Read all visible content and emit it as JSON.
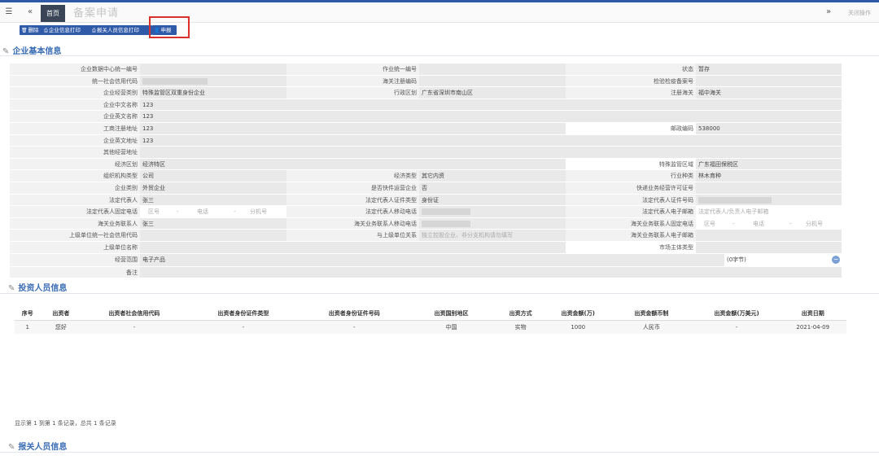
{
  "header": {
    "menu_icon": "hamburger-icon",
    "back_icon": "double-left-icon",
    "home_tab": "首页",
    "current_tab": "备案申请",
    "forward_icon": "double-right-icon",
    "close_ops": "关闭操作"
  },
  "toolbar": {
    "delete": "删除",
    "print_company": "企业信息打印",
    "print_declarer": "报关人员信息打印",
    "submit": "申报"
  },
  "sections": {
    "company": "企业基本信息",
    "investor": "投资人员信息",
    "declarer": "报关人员信息"
  },
  "form": {
    "r1": {
      "l1": "企业数据中心统一编号",
      "v1": "",
      "l2": "作业统一编号",
      "v2": "",
      "l3": "状态",
      "v3": "暂存"
    },
    "r2": {
      "l1": "统一社会信用代码",
      "v1": "",
      "l2": "海关注册编码",
      "v2": "",
      "l3": "检验检疫备案号",
      "v3": ""
    },
    "r3": {
      "l1": "企业经营类别",
      "v1": "特殊监管区双重身份企业",
      "l2": "行政区划",
      "v2": "广东省深圳市南山区",
      "l3": "注册海关",
      "v3": "福中海关"
    },
    "r4": {
      "l1": "企业中文名称",
      "v1": "123"
    },
    "r5": {
      "l1": "企业英文名称",
      "v1": "123"
    },
    "r6": {
      "l1": "工商注册地址",
      "v1": "123",
      "l3": "邮政编码",
      "v3": "538000"
    },
    "r7": {
      "l1": "企业英文地址",
      "v1": "123"
    },
    "r8": {
      "l1": "其他经营地址",
      "v1": ""
    },
    "r9": {
      "l1": "经济区划",
      "v1": "经济特区",
      "l3": "特殊监管区域",
      "v3": "广东福田保税区"
    },
    "r10": {
      "l1": "组织机构类型",
      "v1": "公司",
      "l2": "经济类型",
      "v2": "其它内资",
      "l3": "行业种类",
      "v3": "林木育种"
    },
    "r11": {
      "l1": "企业类别",
      "v1": "外贸企业",
      "l2": "是否快件运营企业",
      "v2": "否",
      "l3": "快递业务经营许可证号",
      "v3": ""
    },
    "r12": {
      "l1": "法定代表人",
      "v1": "张三",
      "l2": "法定代表人证件类型",
      "v2": "身份证",
      "l3": "法定代表人证件号码",
      "v3": ""
    },
    "r13": {
      "l1": "法定代表人固定电话",
      "v1a": "区号",
      "v1b": "电话",
      "v1c": "分机号",
      "l2": "法定代表人移动电话",
      "v2": "",
      "l3": "法定代表人电子邮箱",
      "v3": "法定代表人/负责人电子邮箱"
    },
    "r14": {
      "l1": "海关业务联系人",
      "v1": "张三",
      "l2": "海关业务联系人移动电话",
      "v2": "",
      "l3": "海关业务联系人固定电话",
      "v3a": "区号",
      "v3b": "电话",
      "v3c": "分机号"
    },
    "r15": {
      "l1": "上级单位统一社会信用代码",
      "v1": "",
      "l2": "与上级单位关系",
      "v2": "独立控股企业、非分支机构请勿填写",
      "l3": "海关业务联系人电子邮箱",
      "v3": ""
    },
    "r16": {
      "l1": "上级单位名称",
      "v1": "",
      "l3": "市场主体类型",
      "v3": ""
    },
    "r17": {
      "l1": "经营范围",
      "v1": "电子产品",
      "counter": "(0字节)"
    },
    "r18": {
      "l1": "备注",
      "v1": ""
    }
  },
  "investors": {
    "headers": [
      "序号",
      "出资者",
      "出资者社会信用代码",
      "出资者身份证件类型",
      "出资者身份证件号码",
      "出资国别地区",
      "出资方式",
      "出资金额(万)",
      "出资金额币制",
      "出资金额(万美元)",
      "出资日期"
    ],
    "rows": [
      [
        "1",
        "您好",
        "-",
        "-",
        "-",
        "中国",
        "实物",
        "1000",
        "人民币",
        "-",
        "2021-04-09"
      ]
    ],
    "summary": "显示第 1 到第 1 条记录，总共 1 条记录"
  },
  "colors": {
    "accent": "#2f5aa8",
    "highlight": "#d9312b",
    "section": "#3a6db5"
  }
}
